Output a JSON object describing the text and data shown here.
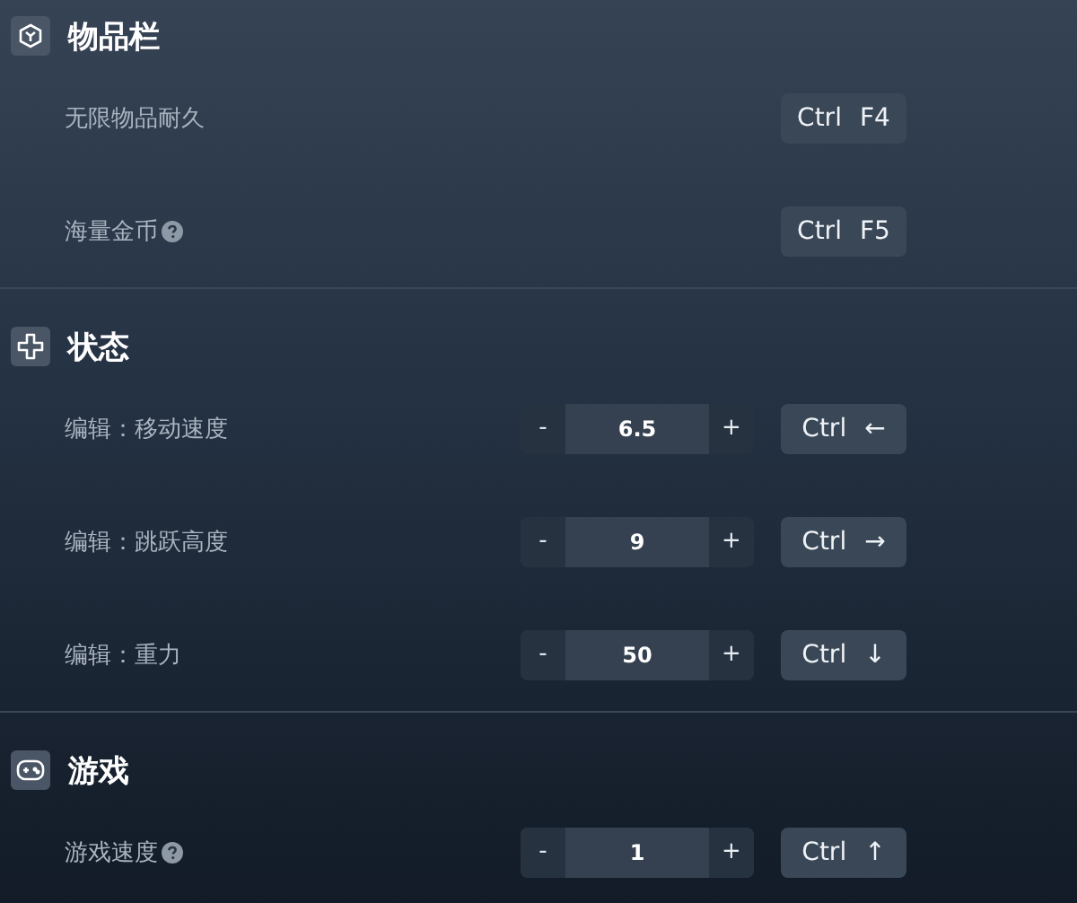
{
  "sections": [
    {
      "title": "物品栏",
      "rows": [
        {
          "kind": "toggle",
          "label": "无限物品耐久",
          "help": false,
          "keys": [
            "Ctrl",
            "F4"
          ]
        },
        {
          "kind": "toggle",
          "label": "海量金币",
          "help": true,
          "keys": [
            "Ctrl",
            "F5"
          ]
        }
      ]
    },
    {
      "title": "状态",
      "rows": [
        {
          "kind": "stepper",
          "label": "编辑：移动速度",
          "help": false,
          "value": "6.5",
          "minus": "-",
          "plus": "+",
          "keys": [
            "Ctrl",
            "←"
          ]
        },
        {
          "kind": "stepper",
          "label": "编辑：跳跃高度",
          "help": false,
          "value": "9",
          "minus": "-",
          "plus": "+",
          "keys": [
            "Ctrl",
            "→"
          ]
        },
        {
          "kind": "stepper",
          "label": "编辑：重力",
          "help": false,
          "value": "50",
          "minus": "-",
          "plus": "+",
          "keys": [
            "Ctrl",
            "↓"
          ]
        }
      ]
    },
    {
      "title": "游戏",
      "rows": [
        {
          "kind": "stepper",
          "label": "游戏速度",
          "help": true,
          "value": "1",
          "minus": "-",
          "plus": "+",
          "keys": [
            "Ctrl",
            "↑"
          ]
        }
      ]
    }
  ]
}
